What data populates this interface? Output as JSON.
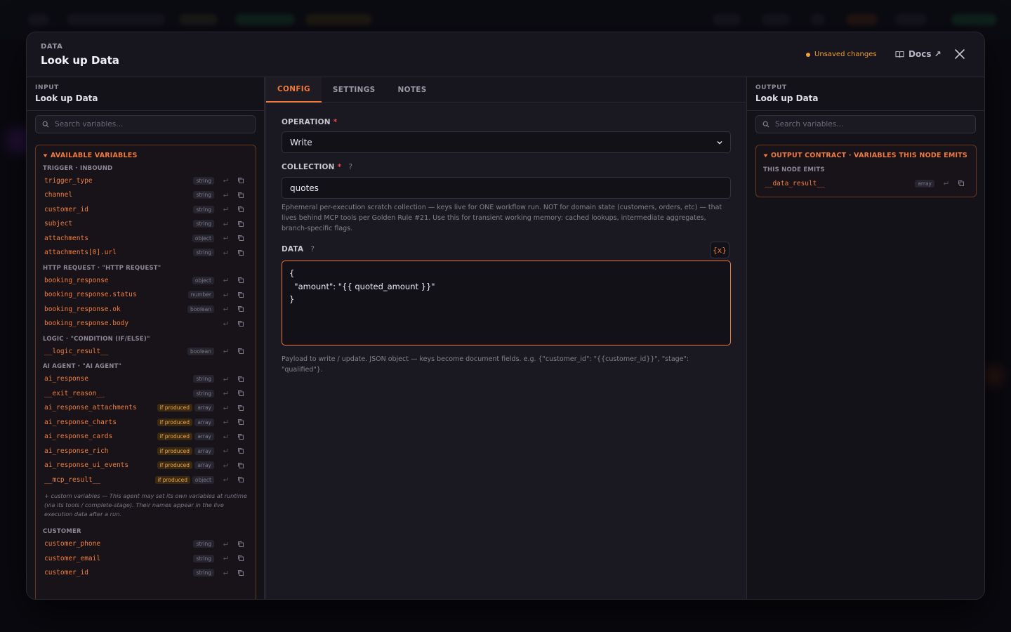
{
  "header": {
    "kicker": "DATA",
    "title": "Look up Data",
    "unsaved": "Unsaved changes",
    "docs": "Docs ↗"
  },
  "colors": {
    "accent": "#f07a3c",
    "warning": "#f0a030",
    "required": "#f04a4a"
  },
  "input": {
    "kicker": "INPUT",
    "title": "Look up Data",
    "search_placeholder": "Search variables...",
    "section_title": "AVAILABLE VARIABLES",
    "groups": [
      {
        "label": "TRIGGER · INBOUND",
        "vars": [
          {
            "name": "trigger_type",
            "type": "string",
            "produced": ""
          },
          {
            "name": "channel",
            "type": "string",
            "produced": ""
          },
          {
            "name": "customer_id",
            "type": "string",
            "produced": ""
          },
          {
            "name": "subject",
            "type": "string",
            "produced": ""
          },
          {
            "name": "attachments",
            "type": "object",
            "produced": ""
          },
          {
            "name": "attachments[0].url",
            "type": "string",
            "produced": ""
          }
        ]
      },
      {
        "label": "HTTP REQUEST · \"HTTP REQUEST\"",
        "vars": [
          {
            "name": "booking_response",
            "type": "object",
            "produced": ""
          },
          {
            "name": "booking_response.status",
            "type": "number",
            "produced": ""
          },
          {
            "name": "booking_response.ok",
            "type": "boolean",
            "produced": ""
          },
          {
            "name": "booking_response.body",
            "type": "",
            "produced": ""
          }
        ]
      },
      {
        "label": "LOGIC · \"CONDITION (IF/ELSE)\"",
        "vars": [
          {
            "name": "__logic_result__",
            "type": "boolean",
            "produced": ""
          }
        ]
      },
      {
        "label": "AI AGENT · \"AI AGENT\"",
        "vars": [
          {
            "name": "ai_response",
            "type": "string",
            "produced": ""
          },
          {
            "name": "__exit_reason__",
            "type": "string",
            "produced": ""
          },
          {
            "name": "ai_response_attachments",
            "type": "array",
            "produced": "if produced"
          },
          {
            "name": "ai_response_charts",
            "type": "array",
            "produced": "if produced"
          },
          {
            "name": "ai_response_cards",
            "type": "array",
            "produced": "if produced"
          },
          {
            "name": "ai_response_rich",
            "type": "array",
            "produced": "if produced"
          },
          {
            "name": "ai_response_ui_events",
            "type": "array",
            "produced": "if produced"
          },
          {
            "name": "__mcp_result__",
            "type": "object",
            "produced": "if produced"
          }
        ]
      }
    ],
    "custom_note": "+ custom variables — This agent may set its own variables at runtime (via its tools / complete-stage). Their names appear in the live execution data after a run.",
    "customer_group": {
      "label": "CUSTOMER",
      "vars": [
        {
          "name": "customer_phone",
          "type": "string"
        },
        {
          "name": "customer_email",
          "type": "string"
        },
        {
          "name": "customer_id",
          "type": "string"
        }
      ]
    }
  },
  "config": {
    "tabs": [
      "CONFIG",
      "SETTINGS",
      "NOTES"
    ],
    "operation_label": "OPERATION",
    "operation_value": "Write",
    "collection_label": "COLLECTION",
    "collection_value": "quotes",
    "collection_help": "Ephemeral per-execution scratch collection — keys live for ONE workflow run. NOT for domain state (customers, orders, etc) — that lives behind MCP tools per Golden Rule #21. Use this for transient working memory: cached lookups, intermediate aggregates, branch-specific flags.",
    "data_label": "DATA",
    "data_button": "{x}",
    "data_value": "{\n  \"amount\": \"{{ quoted_amount }}\"\n}",
    "data_help": "Payload to write / update. JSON object — keys become document fields. e.g. {\"customer_id\": \"{{customer_id}}\", \"stage\": \"qualified\"}."
  },
  "output": {
    "kicker": "OUTPUT",
    "title": "Look up Data",
    "search_placeholder": "Search variables...",
    "section_title": "OUTPUT CONTRACT · VARIABLES THIS NODE EMITS",
    "group_label": "THIS NODE EMITS",
    "vars": [
      {
        "name": "__data_result__",
        "type": "array"
      }
    ]
  }
}
